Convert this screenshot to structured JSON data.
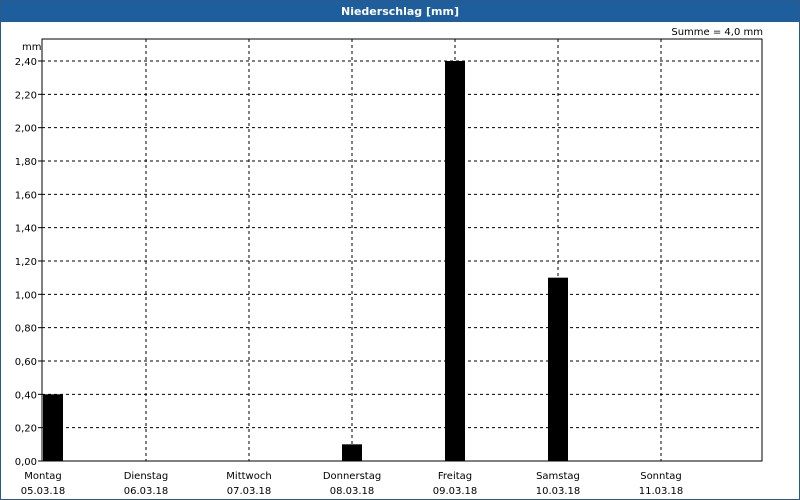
{
  "window": {
    "title": "Niederschlag [mm]"
  },
  "summary": "Summe = 4,0 mm",
  "colors": {
    "bar": "#000000",
    "titlebar": "#1e5e9c",
    "grid": "#000000"
  },
  "chart_data": {
    "type": "bar",
    "title": "Niederschlag [mm]",
    "ylabel": "mm",
    "xlabel": "",
    "ylim": [
      0,
      2.4
    ],
    "y_ticks": [
      "0,00",
      "0,20",
      "0,40",
      "0,60",
      "0,80",
      "1,00",
      "1,20",
      "1,40",
      "1,60",
      "1,80",
      "2,00",
      "2,20",
      "2,40"
    ],
    "categories": [
      {
        "day": "Montag",
        "date": "05.03.18"
      },
      {
        "day": "Dienstag",
        "date": "06.03.18"
      },
      {
        "day": "Mittwoch",
        "date": "07.03.18"
      },
      {
        "day": "Donnerstag",
        "date": "08.03.18"
      },
      {
        "day": "Freitag",
        "date": "09.03.18"
      },
      {
        "day": "Samstag",
        "date": "10.03.18"
      },
      {
        "day": "Sonntag",
        "date": "11.03.18"
      }
    ],
    "values": [
      0.4,
      0.0,
      0.0,
      0.1,
      2.4,
      1.1,
      0.0
    ],
    "grid": true,
    "legend": "none"
  }
}
